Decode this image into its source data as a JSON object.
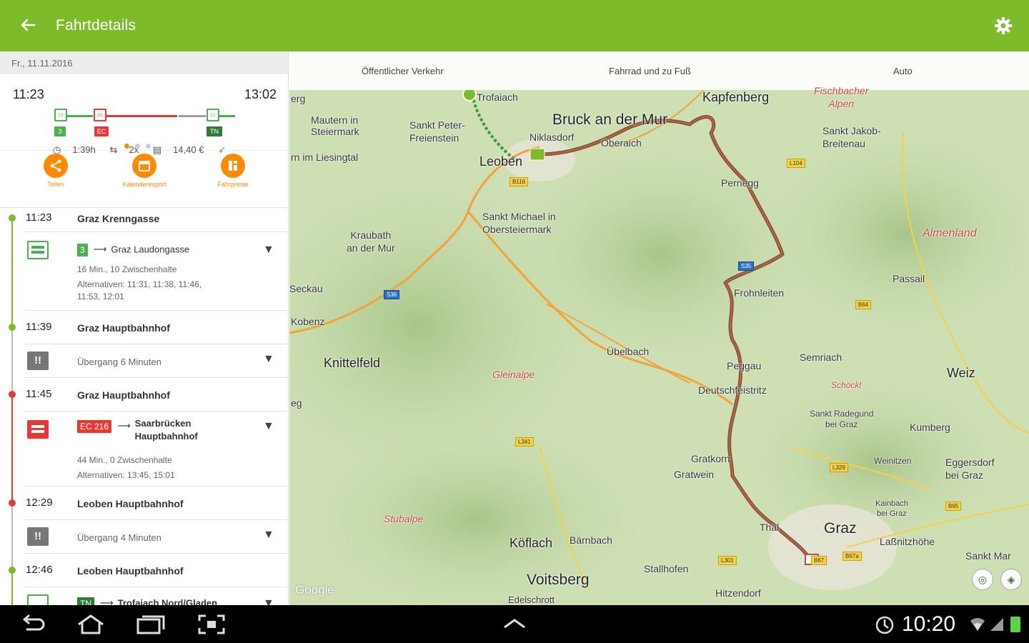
{
  "appbar": {
    "title": "Fahrtdetails",
    "accent": "#7dbb2b"
  },
  "left": {
    "date": "Fr., 11.11.2016",
    "start_time": "11:23",
    "end_time": "13:02",
    "badges": {
      "tram": "3",
      "train": "EC",
      "bus": "TN"
    },
    "stats": {
      "duration": "1:39h",
      "changes": "2x",
      "price": "14,40 €"
    },
    "actions": [
      {
        "label": "Teilen"
      },
      {
        "label": "Kalenderexport"
      },
      {
        "label": "Fahrpreise"
      }
    ],
    "itinerary": {
      "stop1": {
        "time": "11:23",
        "name": "Graz Krenngasse"
      },
      "leg1": {
        "line": "3",
        "dest": "Graz Laudongasse",
        "detail1": "16 Min., 10 Zwischenhalte",
        "detail2": "Alternativen: 11:31, 11:38, 11:46,",
        "detail3": "11:53, 12:01"
      },
      "stop2": {
        "time": "11:39",
        "name": "Graz Hauptbahnhof"
      },
      "transfer1": {
        "text": "Übergang 6 Minuten"
      },
      "stop3": {
        "time": "11:45",
        "name": "Graz Hauptbahnhof"
      },
      "leg2": {
        "line": "EC 216",
        "dest1": "Saarbrücken",
        "dest2": "Hauptbahnhof",
        "detail1": "44 Min., 0 Zwischenhalte",
        "detail2": "Alternativen: 13:45, 15:01"
      },
      "stop4": {
        "time": "12:29",
        "name": "Leoben Hauptbahnhof"
      },
      "transfer2": {
        "text": "Übergang 4 Minuten"
      },
      "stop5": {
        "time": "12:46",
        "name": "Leoben Hauptbahnhof"
      },
      "leg3": {
        "line": "TN",
        "dest": "Trofaiach Nord/Gladen"
      }
    }
  },
  "map": {
    "tabs": [
      "Öffentlicher Verkehr",
      "Fahrrad und zu Fuß",
      "Auto"
    ],
    "places": {
      "bruck": "Bruck an der Mur",
      "kapfenberg": "Kapfenberg",
      "leoben": "Leoben",
      "niklasdorf": "Niklasdorf",
      "oberaich": "Oberaich",
      "trofaiach": "Trofaiach",
      "mautern1": "Mautern in",
      "mautern2": "Steiermark",
      "sanktpeter1": "Sankt Peter-",
      "sanktpeter2": "Freienstein",
      "liesingtal": "rn im Liesingtal",
      "sanktmichael1": "Sankt Michael in",
      "sanktmichael2": "Obersteiermark",
      "kraubath1": "Kraubath",
      "kraubath2": "an der Mur",
      "pernegg": "Pernegg",
      "fischbacher1": "Fischbacher",
      "fischbacher2": "Alpen",
      "sanktjakob1": "Sankt Jakob-",
      "sanktjakob2": "Breitenau",
      "almenland": "Almenland",
      "passail": "Passail",
      "frohnleiten": "Frohnleiten",
      "seckau": "Seckau",
      "kobenz": "Kobenz",
      "knittelfeld": "Knittelfeld",
      "gleinalpe": "Gleinalpe",
      "uebelbach": "Übelbach",
      "peggau": "Peggau",
      "deutschfeistritz": "Deutschfeistritz",
      "semriach": "Semriach",
      "schoeckl": "Schöckl",
      "weiz": "Weiz",
      "sanktradegund1": "Sankt Radegund",
      "sanktradegund2": "bei Graz",
      "kumberg": "Kumberg",
      "gratkorn": "Gratkorn",
      "gratwein": "Gratwein",
      "weinitzen": "Weinitzen",
      "eggersdorf1": "Eggersdorf",
      "eggersdorf2": "bei Graz",
      "stubalpe": "Stubalpe",
      "koeflach": "Köflach",
      "baernbach": "Bärnbach",
      "thal": "Thal",
      "graz": "Graz",
      "kainbach1": "Kainbach",
      "kainbach2": "bei Graz",
      "lassnitzhoehe": "Laßnitzhöhe",
      "voitsberg": "Voitsberg",
      "stallhofen": "Stallhofen",
      "hitzendorf": "Hitzendorf",
      "sanktmar": "Sankt Mar",
      "edelschrott": "Edelschrott",
      "eg": "eg",
      "erg": "erg"
    },
    "roads": [
      "B116",
      "S36",
      "L104",
      "B64",
      "S35",
      "L341",
      "L329",
      "B65",
      "L301",
      "B67",
      "B67a"
    ],
    "google": "Google"
  },
  "system": {
    "time": "10:20"
  }
}
